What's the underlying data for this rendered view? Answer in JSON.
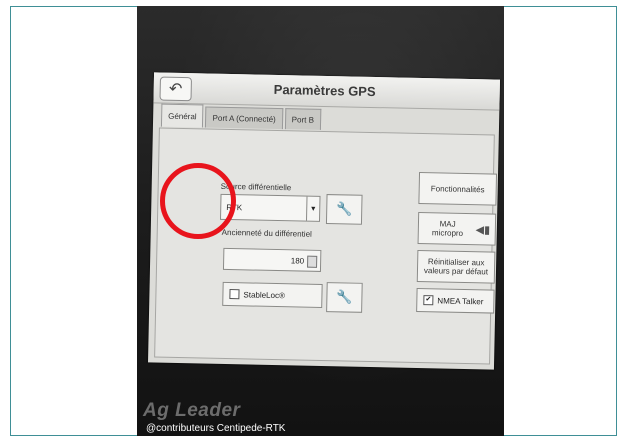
{
  "screen": {
    "title": "Paramètres GPS",
    "back_icon": "back-arrow-icon",
    "tabs": [
      {
        "label": "Général",
        "active": true
      },
      {
        "label": "Port A (Connecté)",
        "active": false
      },
      {
        "label": "Port B",
        "active": false
      }
    ],
    "differential": {
      "label": "Source différentielle",
      "value": "RTK"
    },
    "age": {
      "label": "Ancienneté du différentiel",
      "value": "180"
    },
    "stableloc": {
      "label": "StableLoc®",
      "checked": false
    },
    "side_buttons": {
      "features": "Fonctionnalités",
      "firmware": "MAJ micropro",
      "reset": "Réinitialiser aux valeurs par défaut",
      "nmea": "NMEA Talker"
    },
    "nmea_checked": true
  },
  "annotation": {
    "highlight_color": "#e8141c"
  },
  "brand": "Ag Leader",
  "credit": "@contributeurs Centipede-RTK"
}
